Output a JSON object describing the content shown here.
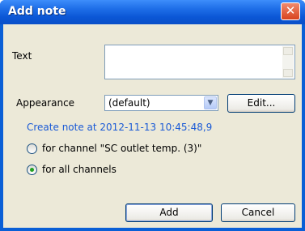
{
  "window": {
    "title": "Add note",
    "close_glyph": "✕"
  },
  "form": {
    "text_label": "Text",
    "text_value": "",
    "appearance_label": "Appearance",
    "appearance_value": "(default)",
    "edit_label": "Edit...",
    "create_note_text": "Create note at 2012-11-13 10:45:48,9",
    "radio_channel_label": "for channel \"SC outlet temp. (3)\"",
    "radio_all_label": "for all channels",
    "selected_radio": "all"
  },
  "buttons": {
    "add": "Add",
    "cancel": "Cancel"
  },
  "icons": {
    "close": "close-icon",
    "dropdown": "chevron-down-icon"
  }
}
